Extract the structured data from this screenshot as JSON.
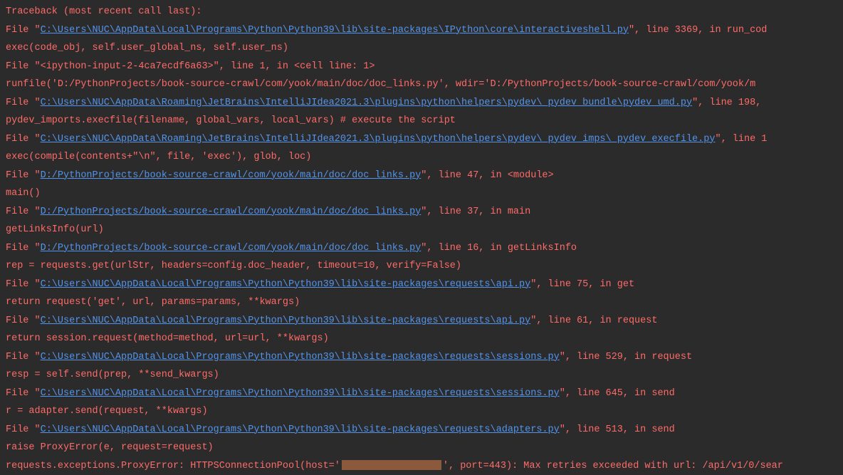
{
  "traceback": {
    "header": "Traceback (most recent call last):",
    "frames": [
      {
        "prefix": "  File \"",
        "path": "C:\\Users\\NUC\\AppData\\Local\\Programs\\Python\\Python39\\lib\\site-packages\\IPython\\core\\interactiveshell.py",
        "suffix": "\", line 3369, in run_cod",
        "code": "    exec(code_obj, self.user_global_ns, self.user_ns)"
      },
      {
        "prefix": "  File \"<ipython-input-2-4ca7ecdf6a63>\", line 1, in <cell line: 1>",
        "path": "",
        "suffix": "",
        "code": "    runfile('D:/PythonProjects/book-source-crawl/com/yook/main/doc/doc_links.py', wdir='D:/PythonProjects/book-source-crawl/com/yook/m"
      },
      {
        "prefix": "  File \"",
        "path": "C:\\Users\\NUC\\AppData\\Roaming\\JetBrains\\IntelliJIdea2021.3\\plugins\\python\\helpers\\pydev\\_pydev_bundle\\pydev_umd.py",
        "suffix": "\", line 198, ",
        "code": "    pydev_imports.execfile(filename, global_vars, local_vars)  # execute the script"
      },
      {
        "prefix": "  File \"",
        "path": "C:\\Users\\NUC\\AppData\\Roaming\\JetBrains\\IntelliJIdea2021.3\\plugins\\python\\helpers\\pydev\\_pydev_imps\\_pydev_execfile.py",
        "suffix": "\", line 1",
        "code": "    exec(compile(contents+\"\\n\", file, 'exec'), glob, loc)"
      },
      {
        "prefix": "  File \"",
        "path": "D:/PythonProjects/book-source-crawl/com/yook/main/doc/doc_links.py",
        "suffix": "\", line 47, in <module>",
        "code": "    main()"
      },
      {
        "prefix": "  File \"",
        "path": "D:/PythonProjects/book-source-crawl/com/yook/main/doc/doc_links.py",
        "suffix": "\", line 37, in main",
        "code": "    getLinksInfo(url)"
      },
      {
        "prefix": "  File \"",
        "path": "D:/PythonProjects/book-source-crawl/com/yook/main/doc/doc_links.py",
        "suffix": "\", line 16, in getLinksInfo",
        "code": "    rep = requests.get(urlStr, headers=config.doc_header, timeout=10, verify=False)"
      },
      {
        "prefix": "  File \"",
        "path": "C:\\Users\\NUC\\AppData\\Local\\Programs\\Python\\Python39\\lib\\site-packages\\requests\\api.py",
        "suffix": "\", line 75, in get",
        "code": "    return request('get', url, params=params, **kwargs)"
      },
      {
        "prefix": "  File \"",
        "path": "C:\\Users\\NUC\\AppData\\Local\\Programs\\Python\\Python39\\lib\\site-packages\\requests\\api.py",
        "suffix": "\", line 61, in request",
        "code": "    return session.request(method=method, url=url, **kwargs)"
      },
      {
        "prefix": "  File \"",
        "path": "C:\\Users\\NUC\\AppData\\Local\\Programs\\Python\\Python39\\lib\\site-packages\\requests\\sessions.py",
        "suffix": "\", line 529, in request",
        "code": "    resp = self.send(prep, **send_kwargs)"
      },
      {
        "prefix": "  File \"",
        "path": "C:\\Users\\NUC\\AppData\\Local\\Programs\\Python\\Python39\\lib\\site-packages\\requests\\sessions.py",
        "suffix": "\", line 645, in send",
        "code": "    r = adapter.send(request, **kwargs)"
      },
      {
        "prefix": "  File \"",
        "path": "C:\\Users\\NUC\\AppData\\Local\\Programs\\Python\\Python39\\lib\\site-packages\\requests\\adapters.py",
        "suffix": "\", line 513, in send",
        "code": "    raise ProxyError(e, request=request)"
      }
    ],
    "exception_prefix": "requests.exceptions.ProxyError: HTTPSConnectionPool(host='",
    "exception_suffix": "', port=443): Max retries exceeded with url: /api/v1/0/sear"
  }
}
